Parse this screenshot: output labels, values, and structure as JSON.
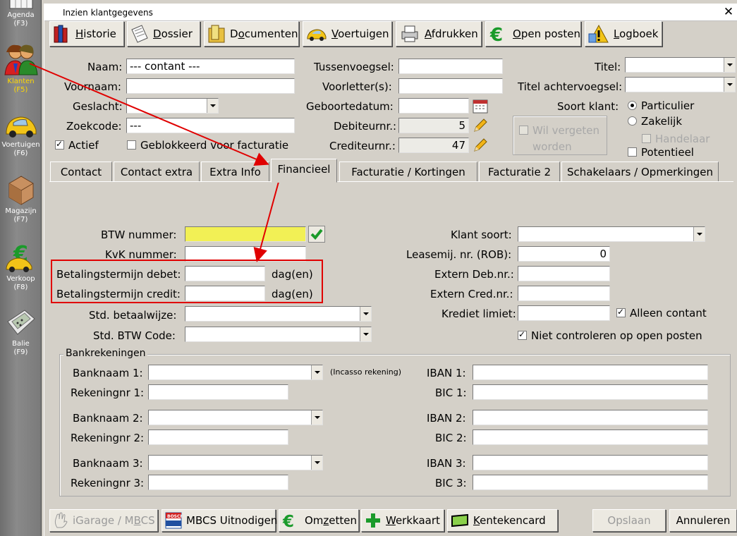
{
  "sidebar": {
    "items": [
      {
        "label": "Agenda",
        "key": "(F3)"
      },
      {
        "label": "Klanten",
        "key": "(F5)"
      },
      {
        "label": "Voertuigen",
        "key": "(F6)"
      },
      {
        "label": "Magazijn",
        "key": "(F7)"
      },
      {
        "label": "Verkoop",
        "key": "(F8)"
      },
      {
        "label": "Balie",
        "key": "(F9)"
      }
    ]
  },
  "window": {
    "title": "Inzien klantgegevens"
  },
  "toolbar": {
    "historie": {
      "pre": "",
      "ul": "H",
      "post": "istorie"
    },
    "dossier": {
      "pre": "",
      "ul": "D",
      "post": "ossier"
    },
    "documenten": {
      "pre": "D",
      "ul": "o",
      "post": "cumenten"
    },
    "voertuigen": {
      "pre": "",
      "ul": "V",
      "post": "oertuigen"
    },
    "afdrukken": {
      "pre": "",
      "ul": "A",
      "post": "fdrukken"
    },
    "open_posten": {
      "pre": "",
      "ul": "O",
      "post": "pen posten"
    },
    "logboek": {
      "pre": "",
      "ul": "L",
      "post": "ogboek"
    }
  },
  "header_form": {
    "naam_label": "Naam:",
    "naam_value": "--- contant ---",
    "voornaam_label": "Voornaam:",
    "voornaam_value": "",
    "geslacht_label": "Geslacht:",
    "geslacht_value": "",
    "zoekcode_label": "Zoekcode:",
    "zoekcode_value": "---",
    "actief_label": "Actief",
    "geblokkeerd_label": "Geblokkeerd voor facturatie",
    "tussenvoegsel_label": "Tussenvoegsel:",
    "voorletters_label": "Voorletter(s):",
    "geboortedatum_label": "Geboortedatum:",
    "debiteurnr_label": "Debiteurnr.:",
    "debiteurnr_value": "5",
    "crediteurnr_label": "Crediteurnr.:",
    "crediteurnr_value": "47",
    "wil_vergeten_label": "Wil vergeten",
    "wil_vergeten_label2": "worden",
    "titel_label": "Titel:",
    "titel_achter_label": "Titel achtervoegsel:",
    "soort_klant_label": "Soort klant:",
    "particulier_label": "Particulier",
    "zakelijk_label": "Zakelijk",
    "handelaar_label": "Handelaar",
    "potentieel_label": "Potentieel"
  },
  "tabs": [
    {
      "label": "Contact"
    },
    {
      "label": "Contact extra"
    },
    {
      "label": "Extra Info"
    },
    {
      "label": "Financieel"
    },
    {
      "label": "Facturatie / Kortingen"
    },
    {
      "label": "Facturatie 2"
    },
    {
      "label": "Schakelaars / Opmerkingen"
    }
  ],
  "financieel": {
    "btw_label": "BTW nummer:",
    "btw_value": "",
    "kvk_label": "KvK nummer:",
    "kvk_value": "",
    "bt_debet_label": "Betalingstermijn debet:",
    "bt_credit_label": "Betalingstermijn credit:",
    "dagen": "dag(en)",
    "std_betaalwijze_label": "Std. betaalwijze:",
    "std_btw_label": "Std. BTW Code:",
    "klant_soort_label": "Klant soort:",
    "leasemij_label": "Leasemij. nr. (ROB):",
    "leasemij_value": "0",
    "extern_deb_label": "Extern Deb.nr.:",
    "extern_cred_label": "Extern Cred.nr.:",
    "krediet_label": "Krediet limiet:",
    "alleen_contant_label": "Alleen contant",
    "niet_controleren_label": "Niet controleren op open posten"
  },
  "bank": {
    "group_title": "Bankrekeningen",
    "banknaam1_label": "Banknaam 1:",
    "incasso": "(Incasso rekening)",
    "rekening1_label": "Rekeningnr 1:",
    "banknaam2_label": "Banknaam 2:",
    "rekening2_label": "Rekeningnr 2:",
    "banknaam3_label": "Banknaam 3:",
    "rekening3_label": "Rekeningnr 3:",
    "iban1_label": "IBAN 1:",
    "bic1_label": "BIC 1:",
    "iban2_label": "IBAN 2:",
    "bic2_label": "BIC 2:",
    "iban3_label": "IBAN 3:",
    "bic3_label": "BIC 3:"
  },
  "bottom": {
    "igarage": "iGarage / MBCS",
    "igarage_pre": "iGarage / M",
    "igarage_ul": "B",
    "igarage_post": "CS",
    "mbcs_uitnodigen": "MBCS Uitnodigen",
    "omzetten_pre": "Om",
    "omzetten_ul": "z",
    "omzetten_post": "etten",
    "werkkaart_pre": "",
    "werkkaart_ul": "W",
    "werkkaart_post": "erkkaart",
    "kentekencard_pre": "",
    "kentekencard_ul": "K",
    "kentekencard_post": "entekencard",
    "opslaan": "Opslaan",
    "annuleren": "Annuleren"
  },
  "colors": {
    "highlight": "#e00000",
    "btw_field": "#f2f055",
    "active_sidebar": "#ffd800"
  }
}
